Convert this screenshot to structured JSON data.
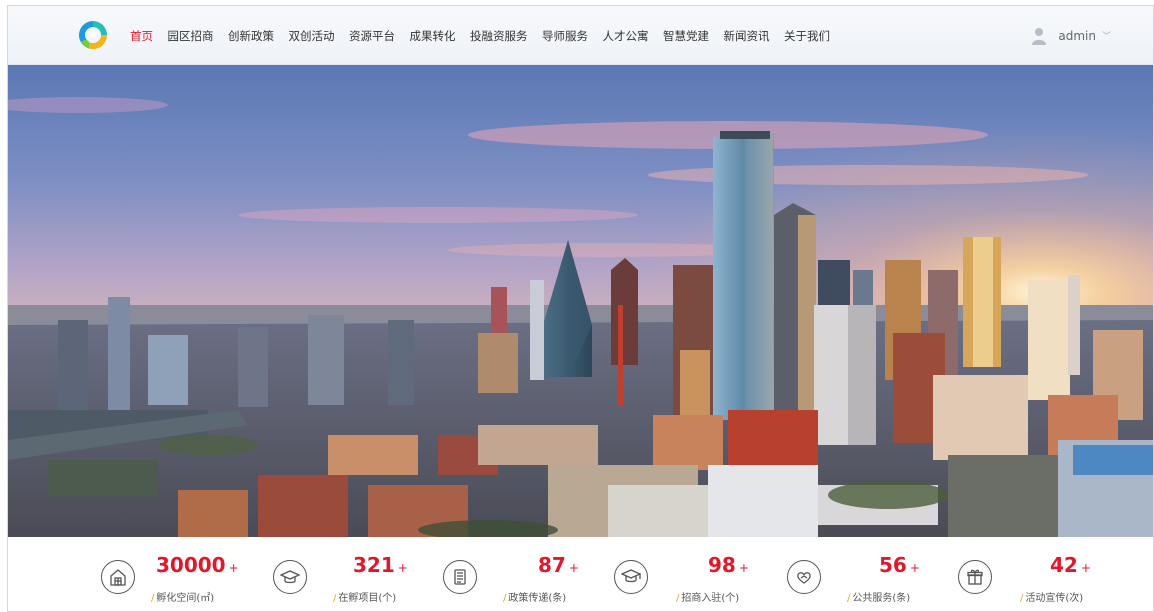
{
  "nav": {
    "items": [
      "首页",
      "园区招商",
      "创新政策",
      "双创活动",
      "资源平台",
      "成果转化",
      "投融资服务",
      "导师服务",
      "人才公寓",
      "智慧党建",
      "新闻资讯",
      "关于我们"
    ],
    "active_index": 0
  },
  "user": {
    "name": "admin"
  },
  "colors": {
    "accent": "#e0182a",
    "label_slash": "#f0a020",
    "icon_stroke": "#555555"
  },
  "stats": [
    {
      "value": "30000",
      "suffix": "+",
      "label": "孵化空间(㎡)",
      "icon": "building-icon"
    },
    {
      "value": "321",
      "suffix": "+",
      "label": "在孵项目(个)",
      "icon": "graduation-cap-icon"
    },
    {
      "value": "87",
      "suffix": "+",
      "label": "政策传递(条)",
      "icon": "document-icon"
    },
    {
      "value": "98",
      "suffix": "+",
      "label": "招商入驻(个)",
      "icon": "mortarboard-icon"
    },
    {
      "value": "56",
      "suffix": "+",
      "label": "公共服务(条)",
      "icon": "heart-hands-icon"
    },
    {
      "value": "42",
      "suffix": "+",
      "label": "活动宣传(次)",
      "icon": "gift-icon"
    }
  ]
}
